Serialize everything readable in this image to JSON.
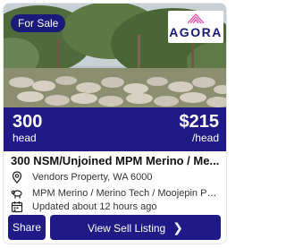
{
  "listing": {
    "badge": "For Sale",
    "logo_text": "AGORA",
    "quantity": "300",
    "quantity_unit": "head",
    "price": "$215",
    "price_unit": "/head",
    "title": "300 NSM/Unjoined MPM Merino / Me...",
    "location": "Vendors Property, WA 6000",
    "breed": "MPM Merino / Merino Tech / Moojepin Perf...",
    "updated": "Updated about 12 hours ago"
  },
  "actions": {
    "share_label": "Share",
    "view_label": "View Sell Listing"
  },
  "colors": {
    "primary": "#1f1a86",
    "badge": "#1a1a7a",
    "logo_accent": "#e040a0"
  },
  "icons": [
    "map-pin-icon",
    "sheep-icon",
    "calendar-icon",
    "chevron-right-icon",
    "agora-logo-icon"
  ]
}
